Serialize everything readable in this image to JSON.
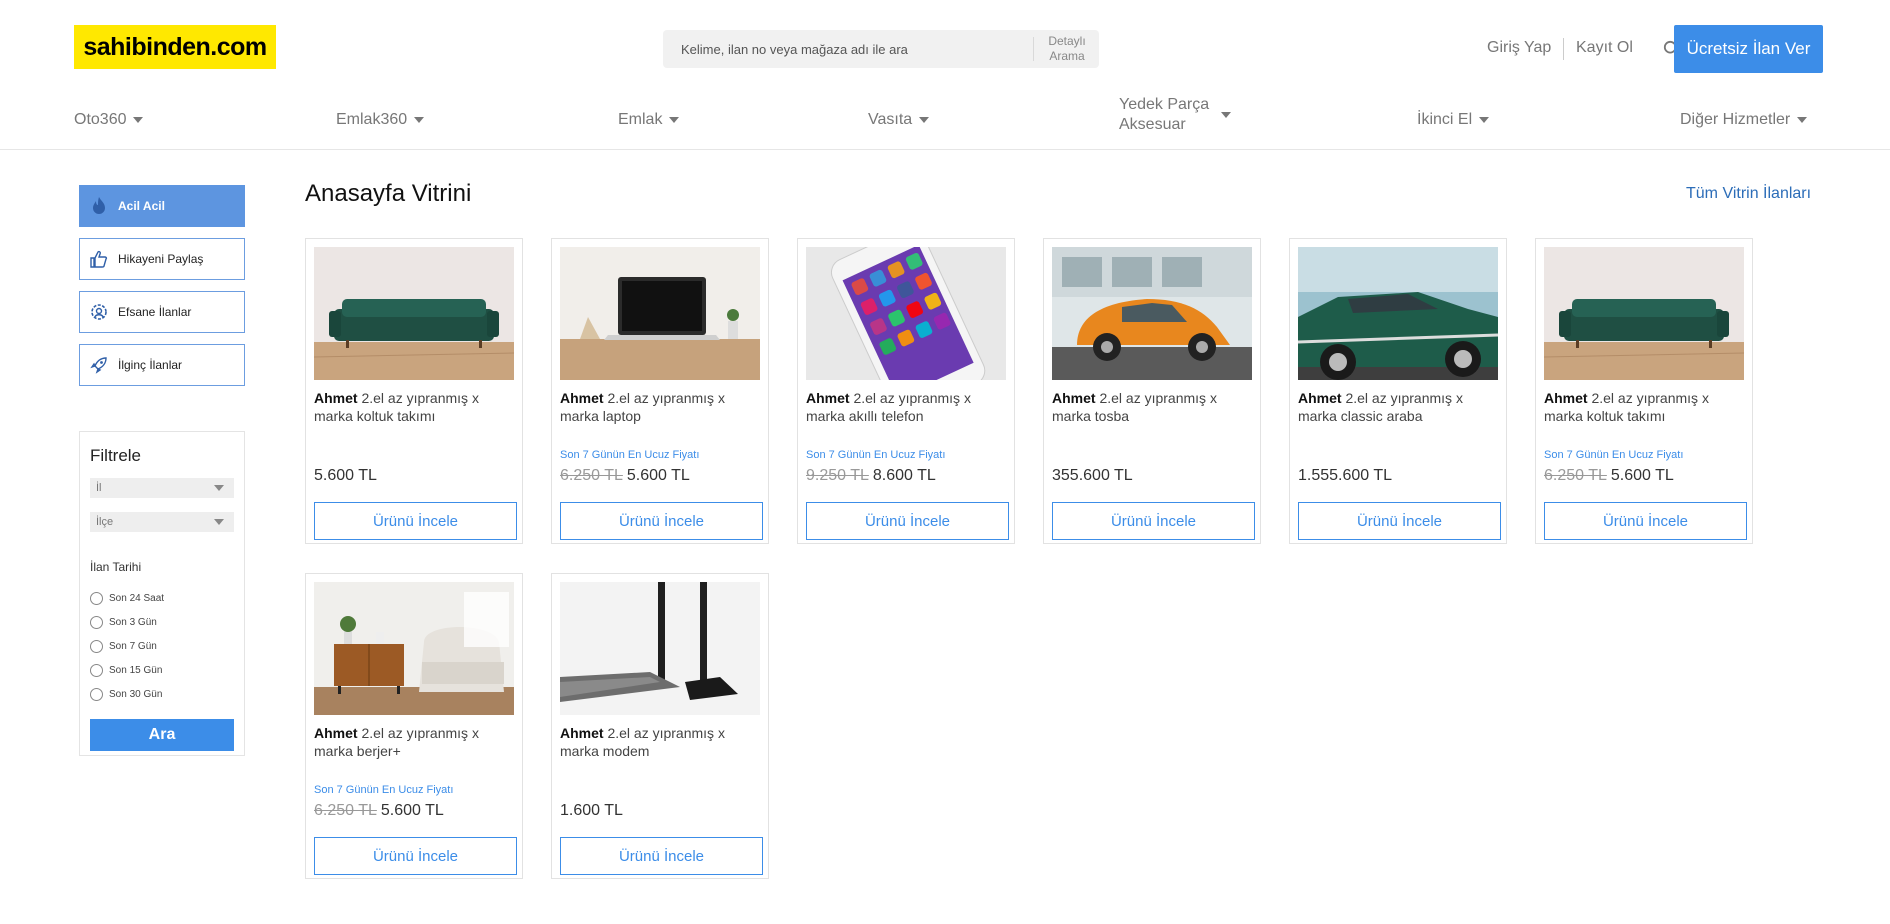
{
  "header": {
    "logo": "sahibinden.com",
    "search_placeholder": "Kelime, ilan no veya mağaza adı ile ara",
    "detailed_search": "Detaylı Arama",
    "login": "Giriş Yap",
    "register": "Kayıt Ol",
    "cta": "Ücretsiz İlan Ver"
  },
  "nav": [
    {
      "label": "Oto360"
    },
    {
      "label": "Emlak360"
    },
    {
      "label": "Emlak"
    },
    {
      "label": "Vasıta"
    },
    {
      "label": "Yedek Parça Aksesuar"
    },
    {
      "label": "İkinci El"
    },
    {
      "label": "Diğer Hizmetler"
    }
  ],
  "sidebar": {
    "buttons": [
      {
        "label": "Acil Acil",
        "icon": "fire-icon"
      },
      {
        "label": "Hikayeni Paylaş",
        "icon": "thumbs-up-icon"
      },
      {
        "label": "Efsane İlanlar",
        "icon": "badge-icon"
      },
      {
        "label": "İlginç İlanlar",
        "icon": "rocket-icon"
      }
    ],
    "filter": {
      "title": "Filtrele",
      "il": "İl",
      "ilce": "İlçe",
      "date_title": "İlan Tarihi",
      "date_options": [
        "Son 24 Saat",
        "Son 3 Gün",
        "Son 7 Gün",
        "Son 15 Gün",
        "Son 30 Gün"
      ],
      "button": "Ara"
    }
  },
  "main": {
    "title": "Anasayfa Vitrini",
    "all_link": "Tüm Vitrin İlanları",
    "button_label": "Ürünü İncele",
    "products": [
      {
        "seller": "Ahmet",
        "title": "2.el az yıpranmış x marka koltuk takımı",
        "note": "",
        "old_price": "",
        "price": "5.600 TL",
        "image": "sofa"
      },
      {
        "seller": "Ahmet",
        "title": "2.el az yıpranmış x marka laptop",
        "note": "Son 7 Günün En Ucuz Fiyatı",
        "old_price": "6.250 TL",
        "price": "5.600 TL",
        "image": "laptop"
      },
      {
        "seller": "Ahmet",
        "title": "2.el az yıpranmış x marka akıllı telefon",
        "note": "Son 7 Günün En Ucuz Fiyatı",
        "old_price": "9.250 TL",
        "price": "8.600 TL",
        "image": "phone"
      },
      {
        "seller": "Ahmet",
        "title": "2.el az yıpranmış x marka tosba",
        "note": "",
        "old_price": "",
        "price": "355.600 TL",
        "image": "beetle"
      },
      {
        "seller": "Ahmet",
        "title": "2.el az yıpranmış x marka classic araba",
        "note": "",
        "old_price": "",
        "price": "1.555.600 TL",
        "image": "classic-car"
      },
      {
        "seller": "Ahmet",
        "title": "2.el az yıpranmış x marka koltuk takımı",
        "note": "Son 7 Günün En Ucuz Fiyatı",
        "old_price": "6.250 TL",
        "price": "5.600 TL",
        "image": "sofa"
      },
      {
        "seller": "Ahmet",
        "title": "2.el az yıpranmış x marka berjer+",
        "note": "Son 7 Günün En Ucuz Fiyatı",
        "old_price": "6.250 TL",
        "price": "5.600 TL",
        "image": "armchair"
      },
      {
        "seller": "Ahmet",
        "title": "2.el az yıpranmış x marka modem",
        "note": "",
        "old_price": "",
        "price": "1.600 TL",
        "image": "modem"
      }
    ]
  },
  "colors": {
    "accent": "#3c8de8",
    "logo_bg": "#ffe800",
    "active_side": "#5d95e0",
    "link": "#2c6db8"
  }
}
